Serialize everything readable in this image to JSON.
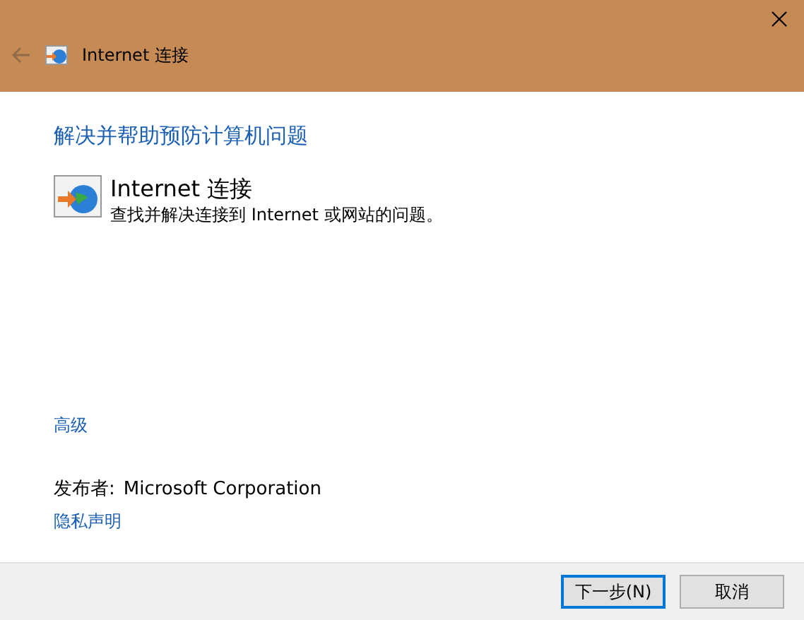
{
  "window": {
    "title": "Internet 连接",
    "back_disabled": true
  },
  "heading": "解决并帮助预防计算机问题",
  "troubleshooter": {
    "title": "Internet 连接",
    "description": "查找并解决连接到 Internet 或网站的问题。"
  },
  "advanced_link": "高级",
  "publisher": {
    "label": "发布者:",
    "value": "Microsoft Corporation"
  },
  "privacy_link": "隐私声明",
  "buttons": [
    {
      "label": "下一步(N)",
      "default": true
    },
    {
      "label": "取消",
      "default": false
    }
  ]
}
